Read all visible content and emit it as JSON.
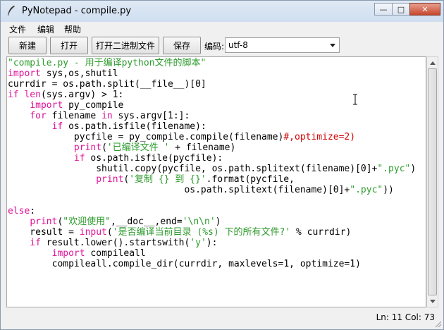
{
  "window": {
    "title": "PyNotepad - compile.py"
  },
  "menu": {
    "items": [
      "文件",
      "编辑",
      "帮助"
    ]
  },
  "toolbar": {
    "new_label": "新建",
    "open_label": "打开",
    "open_binary_label": "打开二进制文件",
    "save_label": "保存",
    "encoding_label": "编码:",
    "encoding_value": "utf-8"
  },
  "editor": {
    "language": "python",
    "lines": [
      "\"compile.py - 用于编译python文件的脚本\"",
      "import sys,os,shutil",
      "currdir = os.path.split(__file__)[0]",
      "if len(sys.argv) > 1:",
      "    import py_compile",
      "    for filename in sys.argv[1:]:",
      "        if os.path.isfile(filename):",
      "            pycfile = py_compile.compile(filename)#,optimize=2)",
      "            print('已编译文件 ' + filename)",
      "            if os.path.isfile(pycfile):",
      "                shutil.copy(pycfile, os.path.splitext(filename)[0]+\".pyc\")",
      "                print('复制 {} 到 {}'.format(pycfile,",
      "                                os.path.splitext(filename)[0]+\".pyc\"))",
      "",
      "else:",
      "    print(\"欢迎使用\",__doc__,end='\\n\\n')",
      "    result = input('是否编译当前目录 (%s) 下的所有文件?' % currdir)",
      "    if result.lower().startswith('y'):",
      "        import compileall",
      "        compileall.compile_dir(currdir, maxlevels=1, optimize=1)"
    ]
  },
  "status": {
    "text": "Ln: 11  Col: 73"
  },
  "colors": {
    "keyword": "#e0139a",
    "string": "#2d9b2d",
    "comment": "#d40000"
  }
}
